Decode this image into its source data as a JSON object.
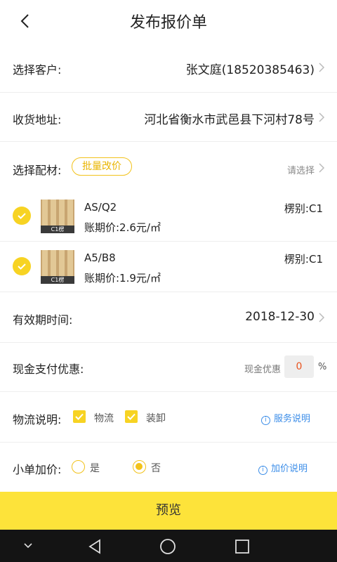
{
  "header": {
    "title": "发布报价单"
  },
  "customer": {
    "label": "选择客户:",
    "value": "张文庭(18520385463)"
  },
  "address": {
    "label": "收货地址:",
    "value": "河北省衡水市武邑县下河村78号"
  },
  "materials": {
    "label": "选择配材:",
    "batch_label": "批量改价",
    "select_hint": "请选择",
    "items": [
      {
        "name": "AS/Q2",
        "price": "账期价:2.6元/㎡",
        "grade": "楞别:C1",
        "thumb_caption": "C1楞",
        "checked": true
      },
      {
        "name": "A5/B8",
        "price": "账期价:1.9元/㎡",
        "grade": "楞别:C1",
        "thumb_caption": "C1楞",
        "checked": true
      }
    ]
  },
  "validity": {
    "label": "有效期时间:",
    "value": "2018-12-30"
  },
  "cash": {
    "label": "现金支付优惠:",
    "hint": "现金优惠",
    "value": "0",
    "unit": "%"
  },
  "logistics": {
    "label": "物流说明:",
    "options": [
      {
        "label": "物流",
        "checked": true
      },
      {
        "label": "装卸",
        "checked": true
      }
    ],
    "info_label": "服务说明"
  },
  "small_order": {
    "label": "小单加价:",
    "options": [
      {
        "label": "是",
        "selected": false
      },
      {
        "label": "否",
        "selected": true
      }
    ],
    "info_label": "加价说明"
  },
  "preview_label": "预览",
  "colors": {
    "accent": "#fde33a",
    "link": "#3b8de8",
    "danger": "#e9531f"
  }
}
